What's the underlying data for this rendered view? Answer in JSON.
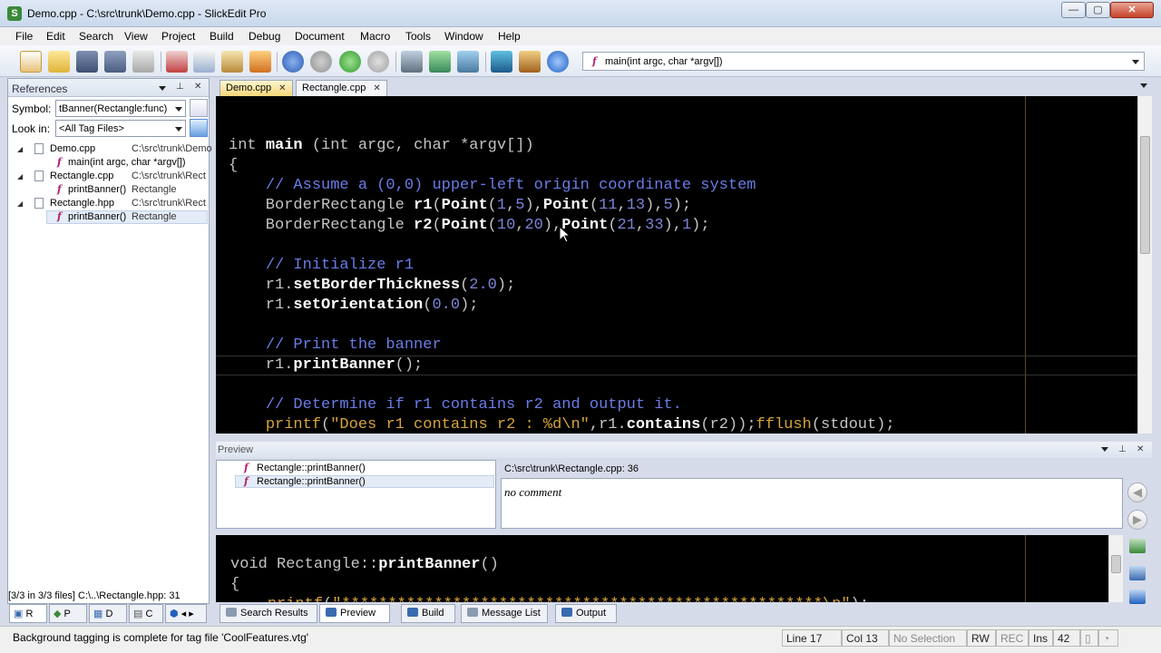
{
  "window": {
    "title": "Demo.cpp - C:\\src\\trunk\\Demo.cpp - SlickEdit Pro",
    "app_icon_glyph": "S",
    "minimize": "—",
    "maximize": "▢",
    "close": "✕"
  },
  "menu": [
    "File",
    "Edit",
    "Search",
    "View",
    "Project",
    "Build",
    "Debug",
    "Document",
    "Macro",
    "Tools",
    "Window",
    "Help"
  ],
  "toolbar": {
    "function_combo": "main(int argc, char *argv[])",
    "function_icon_glyph": "f"
  },
  "references": {
    "title": "References",
    "symbol_label": "Symbol:",
    "symbol_value": "tBanner(Rectangle:func)",
    "lookin_label": "Look in:",
    "lookin_value": "<All Tag Files>",
    "tree": [
      {
        "name": "Demo.cpp",
        "path": "C:\\src\\trunk\\Demo"
      },
      {
        "name": "main(int argc, char *argv[])",
        "path": ""
      },
      {
        "name": "Rectangle.cpp",
        "path": "C:\\src\\trunk\\Rect"
      },
      {
        "name": "printBanner()",
        "path": "Rectangle"
      },
      {
        "name": "Rectangle.hpp",
        "path": "C:\\src\\trunk\\Rect"
      },
      {
        "name": "printBanner()",
        "path": "Rectangle"
      }
    ],
    "status": "[3/3 in 3/3 files] C:\\..\\Rectangle.hpp: 31",
    "panel_tabs": [
      "R",
      "P",
      "D",
      "C"
    ]
  },
  "tabs": [
    {
      "label": "Demo.cpp",
      "close": "✕"
    },
    {
      "label": "Rectangle.cpp",
      "close": "✕"
    }
  ],
  "editor": {
    "lines": [
      {
        "tokens": [
          [
            "kw",
            "int "
          ],
          [
            "fn",
            "main"
          ],
          [
            "kw",
            " ("
          ],
          [
            "kw",
            "int"
          ],
          [
            "kw",
            " argc, "
          ],
          [
            "kw",
            "char"
          ],
          [
            "kw",
            " *argv[])"
          ]
        ]
      },
      {
        "tokens": [
          [
            "kw",
            "{"
          ]
        ]
      },
      {
        "tokens": [
          [
            "kw",
            "    "
          ],
          [
            "cm",
            "// Assume a (0,0) upper-left origin coordinate system"
          ]
        ]
      },
      {
        "tokens": [
          [
            "kw",
            "    BorderRectangle "
          ],
          [
            "fn",
            "r1"
          ],
          [
            "kw",
            "("
          ],
          [
            "fn",
            "Point"
          ],
          [
            "kw",
            "("
          ],
          [
            "num",
            "1"
          ],
          [
            "kw",
            ","
          ],
          [
            "num",
            "5"
          ],
          [
            "kw",
            "),"
          ],
          [
            "fn",
            "Point"
          ],
          [
            "kw",
            "("
          ],
          [
            "num",
            "11"
          ],
          [
            "kw",
            ","
          ],
          [
            "num",
            "13"
          ],
          [
            "kw",
            "),"
          ],
          [
            "num",
            "5"
          ],
          [
            "kw",
            ");"
          ]
        ]
      },
      {
        "tokens": [
          [
            "kw",
            "    BorderRectangle "
          ],
          [
            "fn",
            "r2"
          ],
          [
            "kw",
            "("
          ],
          [
            "fn",
            "Point"
          ],
          [
            "kw",
            "("
          ],
          [
            "num",
            "10"
          ],
          [
            "kw",
            ","
          ],
          [
            "num",
            "20"
          ],
          [
            "kw",
            "),"
          ],
          [
            "fn",
            "Point"
          ],
          [
            "kw",
            "("
          ],
          [
            "num",
            "21"
          ],
          [
            "kw",
            ","
          ],
          [
            "num",
            "33"
          ],
          [
            "kw",
            "),"
          ],
          [
            "num",
            "1"
          ],
          [
            "kw",
            ");"
          ]
        ]
      },
      {
        "tokens": [
          [
            "kw",
            ""
          ]
        ]
      },
      {
        "tokens": [
          [
            "kw",
            "    "
          ],
          [
            "cm",
            "// Initialize r1"
          ]
        ]
      },
      {
        "tokens": [
          [
            "kw",
            "    r1."
          ],
          [
            "fn",
            "setBorderThickness"
          ],
          [
            "kw",
            "("
          ],
          [
            "num",
            "2.0"
          ],
          [
            "kw",
            ");"
          ]
        ]
      },
      {
        "tokens": [
          [
            "kw",
            "    r1."
          ],
          [
            "fn",
            "setOrientation"
          ],
          [
            "kw",
            "("
          ],
          [
            "num",
            "0.0"
          ],
          [
            "kw",
            ");"
          ]
        ]
      },
      {
        "tokens": [
          [
            "kw",
            ""
          ]
        ]
      },
      {
        "tokens": [
          [
            "kw",
            "    "
          ],
          [
            "cm",
            "// Print the banner"
          ]
        ]
      },
      {
        "tokens": [
          [
            "kw",
            "    r1."
          ],
          [
            "fn",
            "printBanner"
          ],
          [
            "kw",
            "();"
          ]
        ]
      },
      {
        "tokens": [
          [
            "kw",
            ""
          ]
        ]
      },
      {
        "tokens": [
          [
            "kw",
            "    "
          ],
          [
            "cm",
            "// Determine if r1 contains r2 and output it."
          ]
        ]
      },
      {
        "tokens": [
          [
            "kw",
            "    "
          ],
          [
            "pf",
            "printf"
          ],
          [
            "kw",
            "("
          ],
          [
            "str",
            "\"Does r1 contains r2 : %d\\n\""
          ],
          [
            "kw",
            ",r1."
          ],
          [
            "fn",
            "contains"
          ],
          [
            "kw",
            "(r2));"
          ],
          [
            "pf",
            "fflush"
          ],
          [
            "kw",
            "(stdout);"
          ]
        ]
      }
    ]
  },
  "preview": {
    "title": "Preview",
    "items": [
      "Rectangle::printBanner()",
      "Rectangle::printBanner()"
    ],
    "path": "C:\\src\\trunk\\Rectangle.cpp: 36",
    "comment": "no comment",
    "code_lines": [
      {
        "tokens": [
          [
            "kw",
            ""
          ]
        ]
      },
      {
        "tokens": [
          [
            "kw",
            "void Rectangle::"
          ],
          [
            "fn",
            "printBanner"
          ],
          [
            "kw",
            "()"
          ]
        ]
      },
      {
        "tokens": [
          [
            "kw",
            "{"
          ]
        ]
      },
      {
        "tokens": [
          [
            "kw",
            "    "
          ],
          [
            "pf",
            "printf"
          ],
          [
            "kw",
            "("
          ],
          [
            "str",
            "\"****************************************************\\n\""
          ],
          [
            "kw",
            ");"
          ]
        ]
      }
    ]
  },
  "bottom_tabs": [
    "Search Results",
    "Preview",
    "Build",
    "Message List",
    "Output"
  ],
  "status": {
    "message": "Background tagging is complete for tag file 'CoolFeatures.vtg'",
    "line": "Line 17",
    "col": "Col 13",
    "selection": "No Selection",
    "rw": "RW",
    "rec": "REC",
    "ins": "Ins",
    "num": "42"
  },
  "colors": {
    "editor_bg": "#000000",
    "comment": "#6a7ce6",
    "number": "#7b84d8",
    "string": "#d6a43a",
    "active_tab": "#f4d679"
  }
}
